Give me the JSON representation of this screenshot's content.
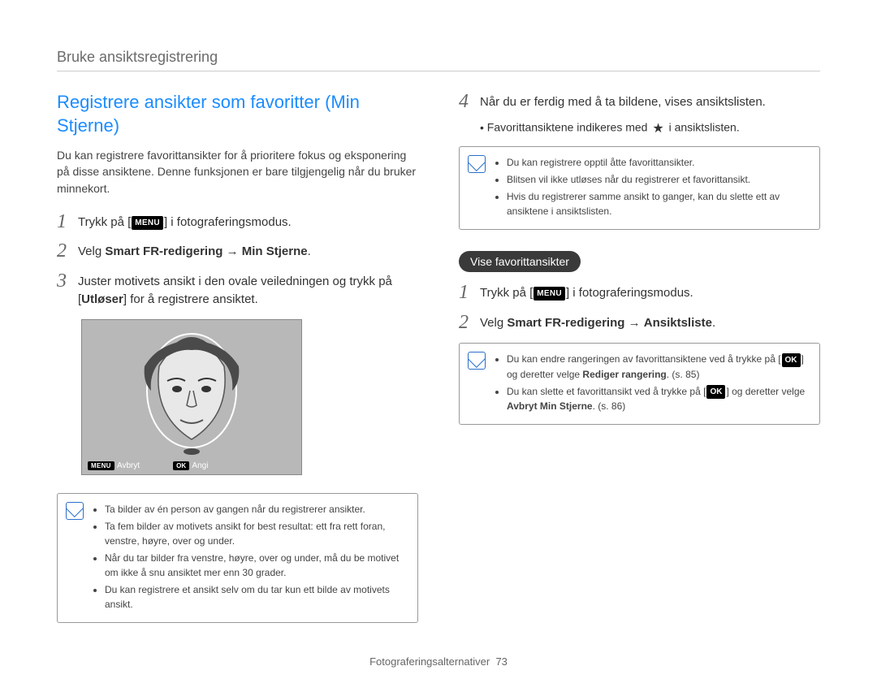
{
  "header": "Bruke ansiktsregistrering",
  "left": {
    "title": "Registrere ansikter som favoritter (Min Stjerne)",
    "intro": "Du kan registrere favorittansikter for å prioritere fokus og eksponering på disse ansiktene. Denne funksjonen er bare tilgjengelig når du bruker minnekort.",
    "steps": [
      {
        "num": "1",
        "pre": "Trykk på [",
        "badge": "MENU",
        "post": "] i fotograferingsmodus."
      },
      {
        "num": "2",
        "html": "Velg <b>Smart FR-redigering</b> → <b>Min Stjerne</b>."
      },
      {
        "num": "3",
        "html": "Juster motivets ansikt i den ovale veiledningen og trykk på [<b>Utløser</b>] for å registrere ansiktet."
      }
    ],
    "frame": {
      "cancel_badge": "MENU",
      "cancel_text": "Avbryt",
      "set_badge": "OK",
      "set_text": "Angi"
    },
    "notes": [
      "Ta bilder av én person av gangen når du registrerer ansikter.",
      "Ta fem bilder av motivets ansikt for best resultat: ett fra rett foran, venstre, høyre, over og under.",
      "Når du tar bilder fra venstre, høyre, over og under, må du be motivet om ikke å snu ansiktet mer enn 30 grader.",
      "Du kan registrere et ansikt selv om du tar kun ett bilde av motivets ansikt."
    ]
  },
  "right": {
    "step4": {
      "num": "4",
      "text": "Når du er ferdig med å ta bildene, vises ansiktslisten."
    },
    "sub_bullet_pre": "Favorittansiktene indikeres med ",
    "sub_bullet_post": " i ansiktslisten.",
    "notes1": [
      "Du kan registrere opptil åtte favorittansikter.",
      "Blitsen vil ikke utløses når du registrerer et favorittansikt.",
      "Hvis du registrerer samme ansikt to ganger, kan du slette ett av ansiktene i ansiktslisten."
    ],
    "pill": "Vise favorittansikter",
    "steps": [
      {
        "num": "1",
        "pre": "Trykk på [",
        "badge": "MENU",
        "post": "] i fotograferingsmodus."
      },
      {
        "num": "2",
        "html": "Velg <b>Smart FR-redigering</b> → <b>Ansiktsliste</b>."
      }
    ],
    "notes2": {
      "line1_pre": "Du kan endre rangeringen av favorittansiktene ved å trykke på [",
      "line1_badge": "OK",
      "line1_mid": "] og deretter velge ",
      "line1_bold": "Rediger rangering",
      "line1_end": ". (s. 85)",
      "line2_pre": "Du kan slette et favorittansikt ved å trykke på [",
      "line2_badge": "OK",
      "line2_mid": "] og deretter velge ",
      "line2_bold": "Avbryt Min Stjerne",
      "line2_end": ". (s. 86)"
    }
  },
  "footer": {
    "label": "Fotograferingsalternativer",
    "page": "73"
  }
}
